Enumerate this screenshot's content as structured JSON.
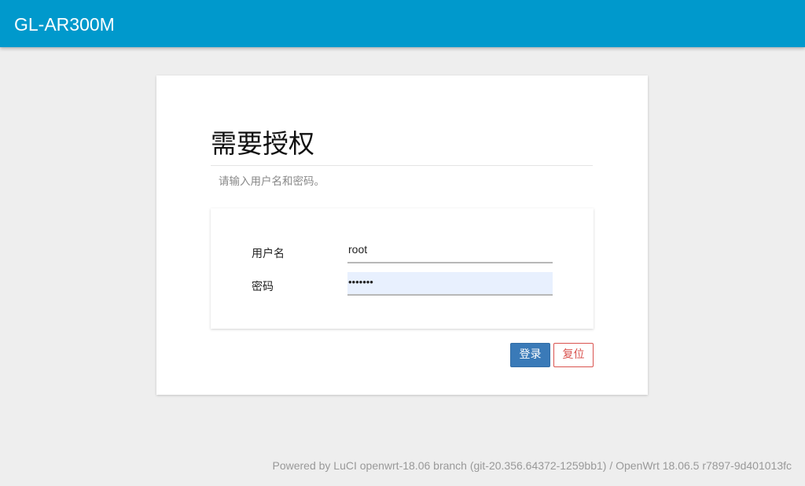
{
  "header": {
    "brand": "GL-AR300M"
  },
  "login": {
    "title": "需要授权",
    "description": "请输入用户名和密码。",
    "username_label": "用户名",
    "username_value": "root",
    "password_label": "密码",
    "password_value": "•••••••",
    "login_button": "登录",
    "reset_button": "复位"
  },
  "footer": {
    "text": "Powered by LuCI openwrt-18.06 branch (git-20.356.64372-1259bb1) / OpenWrt 18.06.5 r7897-9d401013fc"
  },
  "colors": {
    "header_bg": "#0099cc",
    "login_button_bg": "#3a7ab8",
    "reset_button_border": "#d9534f",
    "password_field_bg": "#e8f0fe"
  }
}
